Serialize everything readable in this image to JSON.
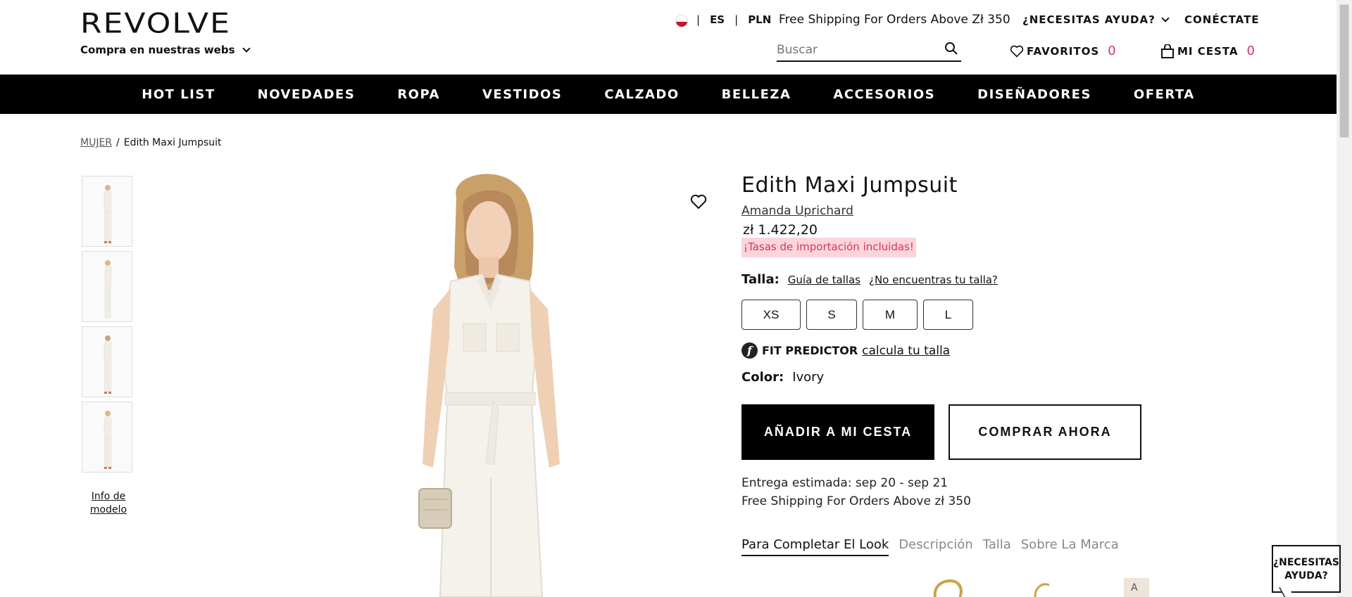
{
  "header": {
    "logo": "REVOLVE",
    "shop_sites": "Compra en nuestras webs",
    "locale": {
      "lang": "ES",
      "currency": "PLN",
      "sep": "|"
    },
    "shipping_notice": "Free Shipping For Orders Above Zł 350",
    "help": "¿NECESITAS AYUDA?",
    "login": "CONÉCTATE",
    "search_placeholder": "Buscar",
    "favorites_label": "FAVORITOS",
    "favorites_count": "0",
    "cart_label": "MI CESTA",
    "cart_count": "0"
  },
  "nav": [
    "HOT LIST",
    "NOVEDADES",
    "ROPA",
    "VESTIDOS",
    "CALZADO",
    "BELLEZA",
    "ACCESORIOS",
    "DISEÑADORES",
    "OFERTA"
  ],
  "breadcrumb": {
    "parent": "MUJER",
    "sep": "/",
    "current": "Edith Maxi Jumpsuit"
  },
  "gallery": {
    "thumbnail_count": 4,
    "model_info": "Info de modelo"
  },
  "product": {
    "title": "Edith Maxi Jumpsuit",
    "brand": "Amanda Uprichard",
    "price": "zł 1.422,20",
    "duties_note": "¡Tasas de importación incluidas!",
    "size_label": "Talla:",
    "size_guide": "Guía de tallas",
    "size_missing": "¿No encuentras tu talla?",
    "sizes": [
      "XS",
      "S",
      "M",
      "L"
    ],
    "fit_predictor_label": "FIT PREDICTOR",
    "fit_predictor_link": "calcula tu talla",
    "color_label": "Color:",
    "color_value": "Ivory",
    "add_to_cart": "AÑADIR A MI CESTA",
    "buy_now": "COMPRAR AHORA",
    "delivery_estimate": "Entrega estimada: sep 20 - sep 21",
    "delivery_shipping": "Free Shipping For Orders Above zł 350",
    "tabs": [
      "Para Completar El Look",
      "Descripción",
      "Talla",
      "Sobre La Marca"
    ]
  },
  "help_bubble": "¿NECESITAS AYUDA?",
  "colors": {
    "accent": "#d6336c",
    "duties_bg": "#fbd5d9",
    "nav_bg": "#000000"
  }
}
